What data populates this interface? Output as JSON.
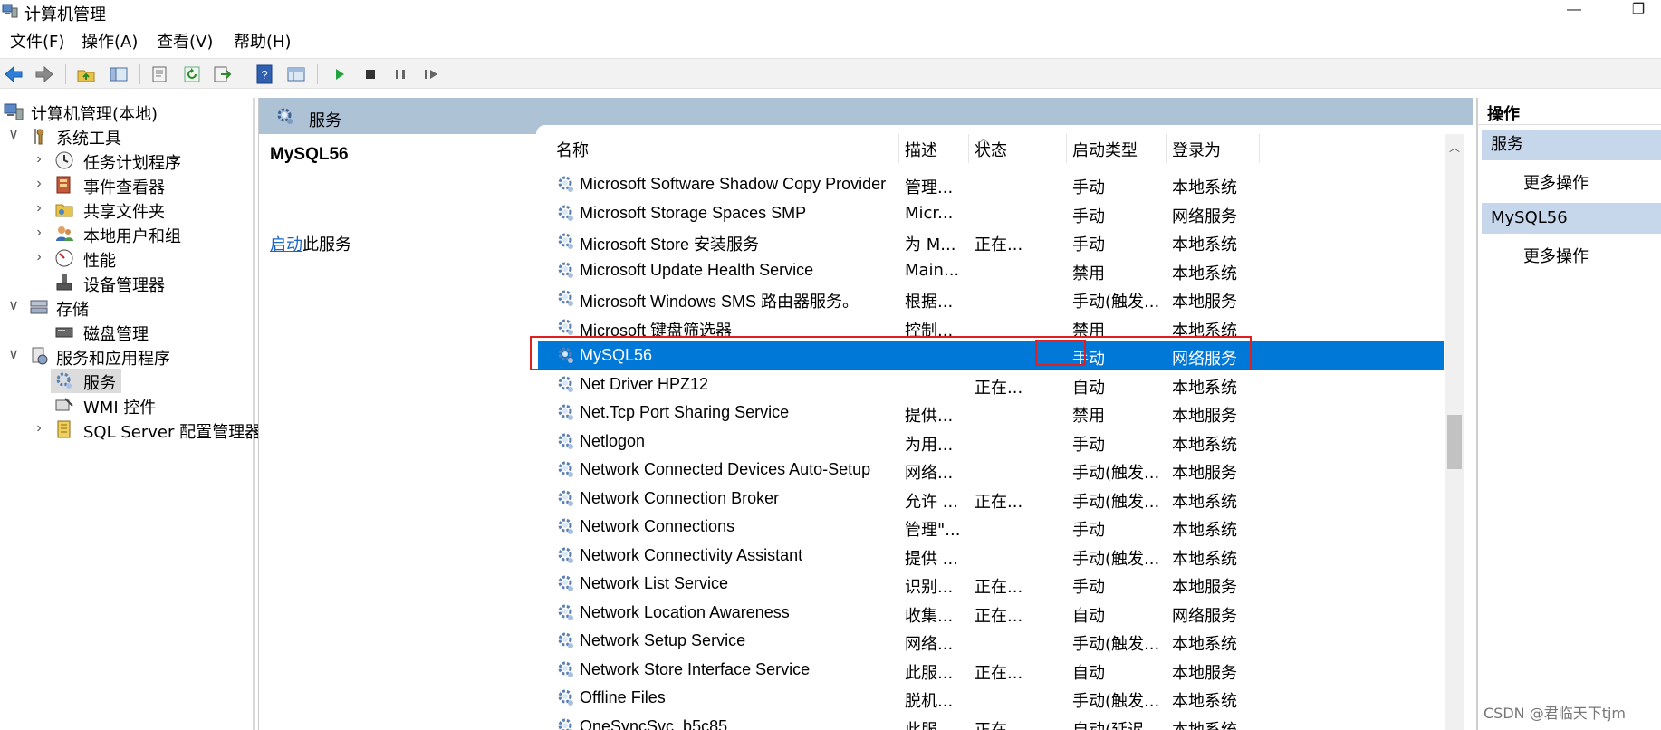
{
  "window": {
    "title": "计算机管理",
    "minimize": "—",
    "restore": "❐"
  },
  "menu": [
    "文件(F)",
    "操作(A)",
    "查看(V)",
    "帮助(H)"
  ],
  "tree": [
    {
      "label": "计算机管理(本地)",
      "level": 0,
      "arrow": "",
      "icon": "computer-management-icon"
    },
    {
      "label": "系统工具",
      "level": 1,
      "arrow": "∨",
      "icon": "system-tools-icon"
    },
    {
      "label": "任务计划程序",
      "level": 2,
      "arrow": "›",
      "icon": "task-scheduler-icon"
    },
    {
      "label": "事件查看器",
      "level": 2,
      "arrow": "›",
      "icon": "event-viewer-icon"
    },
    {
      "label": "共享文件夹",
      "level": 2,
      "arrow": "›",
      "icon": "shared-folders-icon"
    },
    {
      "label": "本地用户和组",
      "level": 2,
      "arrow": "›",
      "icon": "local-users-icon"
    },
    {
      "label": "性能",
      "level": 2,
      "arrow": "›",
      "icon": "performance-icon"
    },
    {
      "label": "设备管理器",
      "level": 2,
      "arrow": "",
      "icon": "device-manager-icon"
    },
    {
      "label": "存储",
      "level": 1,
      "arrow": "∨",
      "icon": "storage-icon"
    },
    {
      "label": "磁盘管理",
      "level": 2,
      "arrow": "",
      "icon": "disk-management-icon"
    },
    {
      "label": "服务和应用程序",
      "level": 1,
      "arrow": "∨",
      "icon": "services-apps-icon"
    },
    {
      "label": "服务",
      "level": 2,
      "arrow": "",
      "icon": "services-icon",
      "selected": true
    },
    {
      "label": "WMI 控件",
      "level": 2,
      "arrow": "",
      "icon": "wmi-icon"
    },
    {
      "label": "SQL Server 配置管理器",
      "level": 2,
      "arrow": "›",
      "icon": "sql-server-icon"
    }
  ],
  "center": {
    "header": "服务",
    "selected_service": "MySQL56",
    "action_link": "启动",
    "action_text": "此服务"
  },
  "columns": {
    "name": "名称",
    "desc": "描述",
    "status": "状态",
    "startup": "启动类型",
    "logon": "登录为"
  },
  "services": [
    {
      "name": "Microsoft Software Shadow Copy Provider",
      "desc": "管理...",
      "status": "",
      "startup": "手动",
      "logon": "本地系统"
    },
    {
      "name": "Microsoft Storage Spaces SMP",
      "desc": "Micr...",
      "status": "",
      "startup": "手动",
      "logon": "网络服务"
    },
    {
      "name": "Microsoft Store 安装服务",
      "desc": "为 M...",
      "status": "正在...",
      "startup": "手动",
      "logon": "本地系统"
    },
    {
      "name": "Microsoft Update Health Service",
      "desc": "Main...",
      "status": "",
      "startup": "禁用",
      "logon": "本地系统"
    },
    {
      "name": "Microsoft Windows SMS 路由器服务。",
      "desc": "根据...",
      "status": "",
      "startup": "手动(触发...",
      "logon": "本地服务"
    },
    {
      "name": "Microsoft 键盘筛选器",
      "desc": "控制...",
      "status": "",
      "startup": "禁用",
      "logon": "本地系统"
    },
    {
      "name": "MySQL56",
      "desc": "",
      "status": "",
      "startup": "手动",
      "logon": "网络服务",
      "selected": true
    },
    {
      "name": "Net Driver HPZ12",
      "desc": "",
      "status": "正在...",
      "startup": "自动",
      "logon": "本地系统"
    },
    {
      "name": "Net.Tcp Port Sharing Service",
      "desc": "提供...",
      "status": "",
      "startup": "禁用",
      "logon": "本地服务"
    },
    {
      "name": "Netlogon",
      "desc": "为用...",
      "status": "",
      "startup": "手动",
      "logon": "本地系统"
    },
    {
      "name": "Network Connected Devices Auto-Setup",
      "desc": "网络...",
      "status": "",
      "startup": "手动(触发...",
      "logon": "本地服务"
    },
    {
      "name": "Network Connection Broker",
      "desc": "允许 ...",
      "status": "正在...",
      "startup": "手动(触发...",
      "logon": "本地系统"
    },
    {
      "name": "Network Connections",
      "desc": "管理\"...",
      "status": "",
      "startup": "手动",
      "logon": "本地系统"
    },
    {
      "name": "Network Connectivity Assistant",
      "desc": "提供 ...",
      "status": "",
      "startup": "手动(触发...",
      "logon": "本地系统"
    },
    {
      "name": "Network List Service",
      "desc": "识别...",
      "status": "正在...",
      "startup": "手动",
      "logon": "本地服务"
    },
    {
      "name": "Network Location Awareness",
      "desc": "收集...",
      "status": "正在...",
      "startup": "自动",
      "logon": "网络服务"
    },
    {
      "name": "Network Setup Service",
      "desc": "网络...",
      "status": "",
      "startup": "手动(触发...",
      "logon": "本地系统"
    },
    {
      "name": "Network Store Interface Service",
      "desc": "此服...",
      "status": "正在...",
      "startup": "自动",
      "logon": "本地服务"
    },
    {
      "name": "Offline Files",
      "desc": "脱机...",
      "status": "",
      "startup": "手动(触发...",
      "logon": "本地系统"
    },
    {
      "name": "OneSyncSvc_b5c85",
      "desc": "此服...",
      "status": "正在...",
      "startup": "自动(延迟...",
      "logon": "本地系统"
    }
  ],
  "actions": {
    "header": "操作",
    "sections": [
      {
        "title": "服务",
        "item": "更多操作"
      },
      {
        "title": "MySQL56",
        "item": "更多操作"
      }
    ]
  },
  "watermark": "CSDN @君临天下tjm",
  "colors": {
    "selection": "#0078d7",
    "header_band": "#aec2d6",
    "action_section": "#c6d7ec",
    "highlight_box": "#e02020"
  }
}
